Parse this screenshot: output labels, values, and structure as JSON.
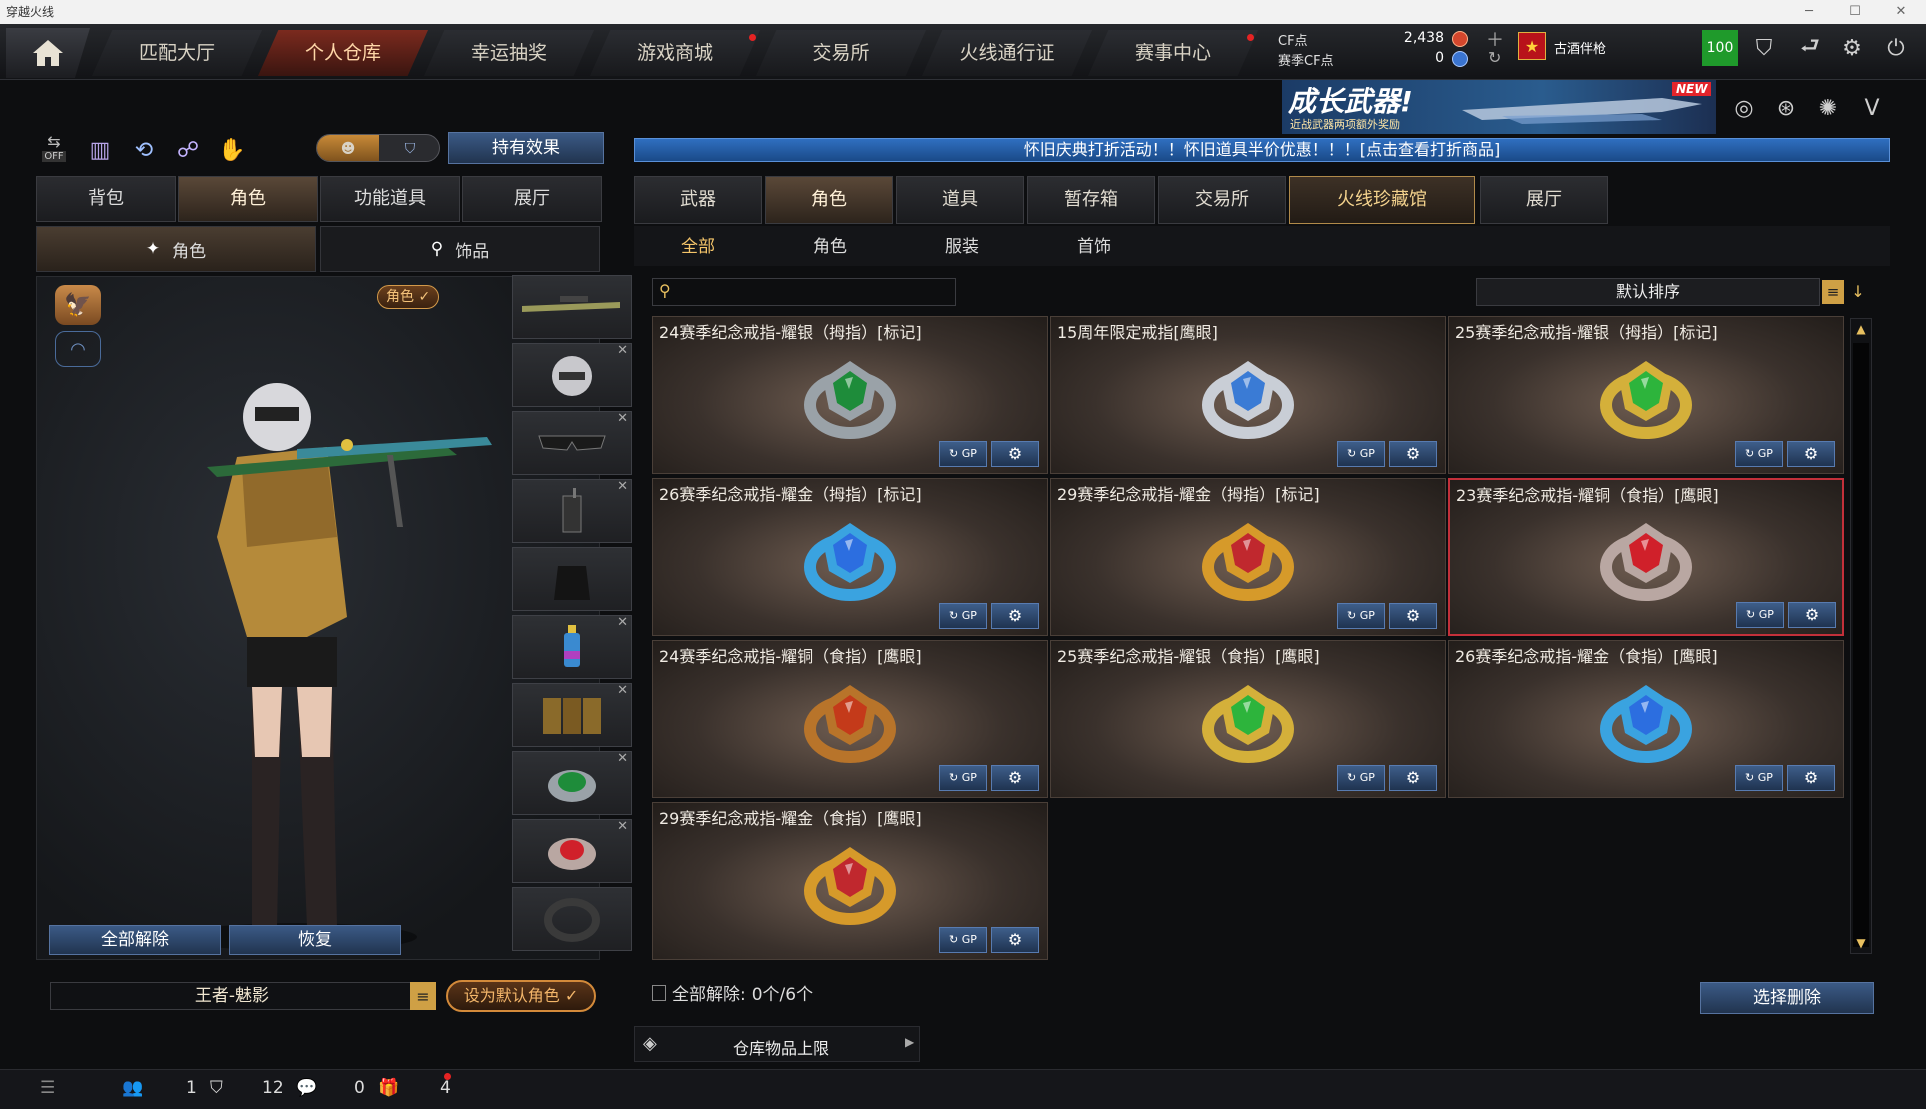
{
  "window": {
    "title": "穿越火线"
  },
  "nav": {
    "tabs": [
      {
        "label": "匹配大厅",
        "active": false,
        "dot": false
      },
      {
        "label": "个人仓库",
        "active": true,
        "dot": false
      },
      {
        "label": "幸运抽奖",
        "active": false,
        "dot": false
      },
      {
        "label": "游戏商城",
        "active": false,
        "dot": true
      },
      {
        "label": "交易所",
        "active": false,
        "dot": false
      },
      {
        "label": "火线通行证",
        "active": false,
        "dot": false
      },
      {
        "label": "赛事中心",
        "active": false,
        "dot": true
      }
    ],
    "cf_label": "CF点",
    "cf_value": "2,438",
    "season_cf_label": "赛季CF点",
    "season_cf_value": "0",
    "username": "古酒伴枪",
    "level": "100"
  },
  "banner": {
    "title": "成长武器!",
    "subtitle": "近战武器两项额外奖励",
    "badge": "NEW"
  },
  "left": {
    "effects_button": "持有效果",
    "toggle_off": "OFF",
    "tabs": [
      "背包",
      "角色",
      "功能道具",
      "展厅"
    ],
    "active_tab": 1,
    "subtabs": [
      "角色",
      "饰品"
    ],
    "role_badge": "角色 ✓",
    "remove_all": "全部解除",
    "restore": "恢复",
    "role_name": "王者-魅影",
    "set_default": "设为默认角色 ✓"
  },
  "right": {
    "notice": "怀旧庆典打折活动！！怀旧道具半价优惠！！！[点击查看打折商品]",
    "tabs": [
      "武器",
      "角色",
      "道具",
      "暂存箱",
      "交易所",
      "火线珍藏馆",
      "展厅"
    ],
    "active_tab": 1,
    "subtabs": [
      "全部",
      "角色",
      "服装",
      "首饰"
    ],
    "sort_label": "默认排序",
    "items": [
      {
        "title": "24赛季纪念戒指-耀银（拇指）[标记]",
        "gem": "#1e8c3a",
        "metal": "#9aa2a8"
      },
      {
        "title": "15周年限定戒指[鹰眼]",
        "gem": "#3a7bd5",
        "metal": "#c9ced6"
      },
      {
        "title": "25赛季纪念戒指-耀银（拇指）[标记]",
        "gem": "#2db43c",
        "metal": "#d4b03a"
      },
      {
        "title": "26赛季纪念戒指-耀金（拇指）[标记]",
        "gem": "#2c6ee0",
        "metal": "#3aa3e0"
      },
      {
        "title": "29赛季纪念戒指-耀金（拇指）[标记]",
        "gem": "#c0282e",
        "metal": "#d69a2a"
      },
      {
        "title": "23赛季纪念戒指-耀铜（食指）[鹰眼]",
        "gem": "#d0202a",
        "metal": "#b9a7a2"
      },
      {
        "title": "24赛季纪念戒指-耀铜（食指）[鹰眼]",
        "gem": "#c43a1a",
        "metal": "#b8742a"
      },
      {
        "title": "25赛季纪念戒指-耀银（食指）[鹰眼]",
        "gem": "#2db43c",
        "metal": "#d4b03a"
      },
      {
        "title": "26赛季纪念戒指-耀金（食指）[鹰眼]",
        "gem": "#2c6ee0",
        "metal": "#3aa3e0"
      },
      {
        "title": "29赛季纪念戒指-耀金（食指）[鹰眼]",
        "gem": "#c0282e",
        "metal": "#d69a2a"
      }
    ],
    "selected_index": 5,
    "gp_label": "GP",
    "remove_all_label": "全部解除:",
    "remove_count": "0个/6个",
    "select_delete": "选择删除",
    "storage_limit": "仓库物品上限"
  },
  "bottom": {
    "count1": "1",
    "count2": "12",
    "count3": "0",
    "count4": "4"
  }
}
